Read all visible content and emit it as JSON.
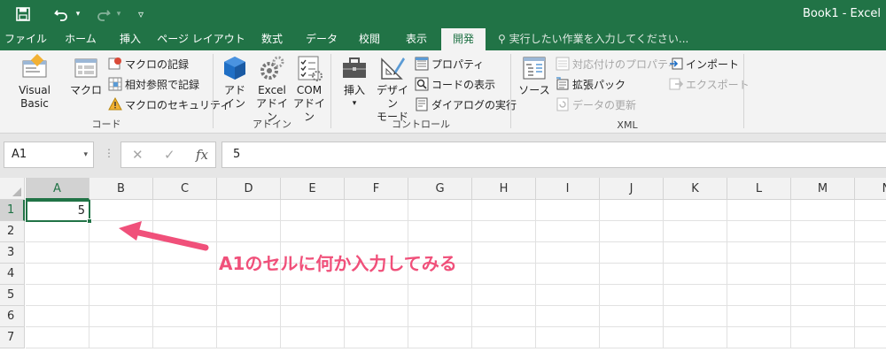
{
  "titlebar": {
    "title": "Book1 - Excel",
    "qa": {
      "save": "save-icon",
      "undo": "undo-icon",
      "redo": "redo-icon",
      "customize": "▿"
    }
  },
  "tabs": [
    "ファイル",
    "ホーム",
    "挿入",
    "ページ レイアウト",
    "数式",
    "データ",
    "校閲",
    "表示",
    "開発"
  ],
  "tell_me": "実行したい作業を入力してください...",
  "ribbon": {
    "code": {
      "label": "コード",
      "visual_basic": "Visual Basic",
      "macro": "マクロ",
      "record_macro": "マクロの記録",
      "relative_ref": "相対参照で記録",
      "macro_security": "マクロのセキュリティ"
    },
    "addins": {
      "label": "アドイン",
      "addin_l1": "アド",
      "addin_l2": "イン",
      "excel_addin_l1": "Excel",
      "excel_addin_l2": "アドイン",
      "com_addin_l1": "COM",
      "com_addin_l2": "アドイン"
    },
    "controls": {
      "label": "コントロール",
      "insert": "挿入",
      "insert_arrow": "▾",
      "design_l1": "デザイン",
      "design_l2": "モード",
      "properties": "プロパティ",
      "view_code": "コードの表示",
      "run_dialog": "ダイアログの実行"
    },
    "xml": {
      "label": "XML",
      "source": "ソース",
      "map_properties": "対応付けのプロパティ",
      "expansion_packs": "拡張パック",
      "refresh_data": "データの更新",
      "import": "インポート",
      "export": "エクスポート"
    }
  },
  "formula_bar": {
    "name_box": "A1",
    "name_box_arrow": "▾",
    "dots": "⋮",
    "cancel": "✕",
    "enter": "✓",
    "fx": "fx",
    "value": "5"
  },
  "grid": {
    "columns": [
      "A",
      "B",
      "C",
      "D",
      "E",
      "F",
      "G",
      "H",
      "I",
      "J",
      "K",
      "L",
      "M",
      "N"
    ],
    "rows": [
      "1",
      "2",
      "3",
      "4",
      "5",
      "6",
      "7"
    ],
    "active_cell_value": "5"
  },
  "annotation": "A1のセルに何か入力してみる",
  "colors": {
    "brand": "#217346",
    "annotation": "#f0507a"
  }
}
